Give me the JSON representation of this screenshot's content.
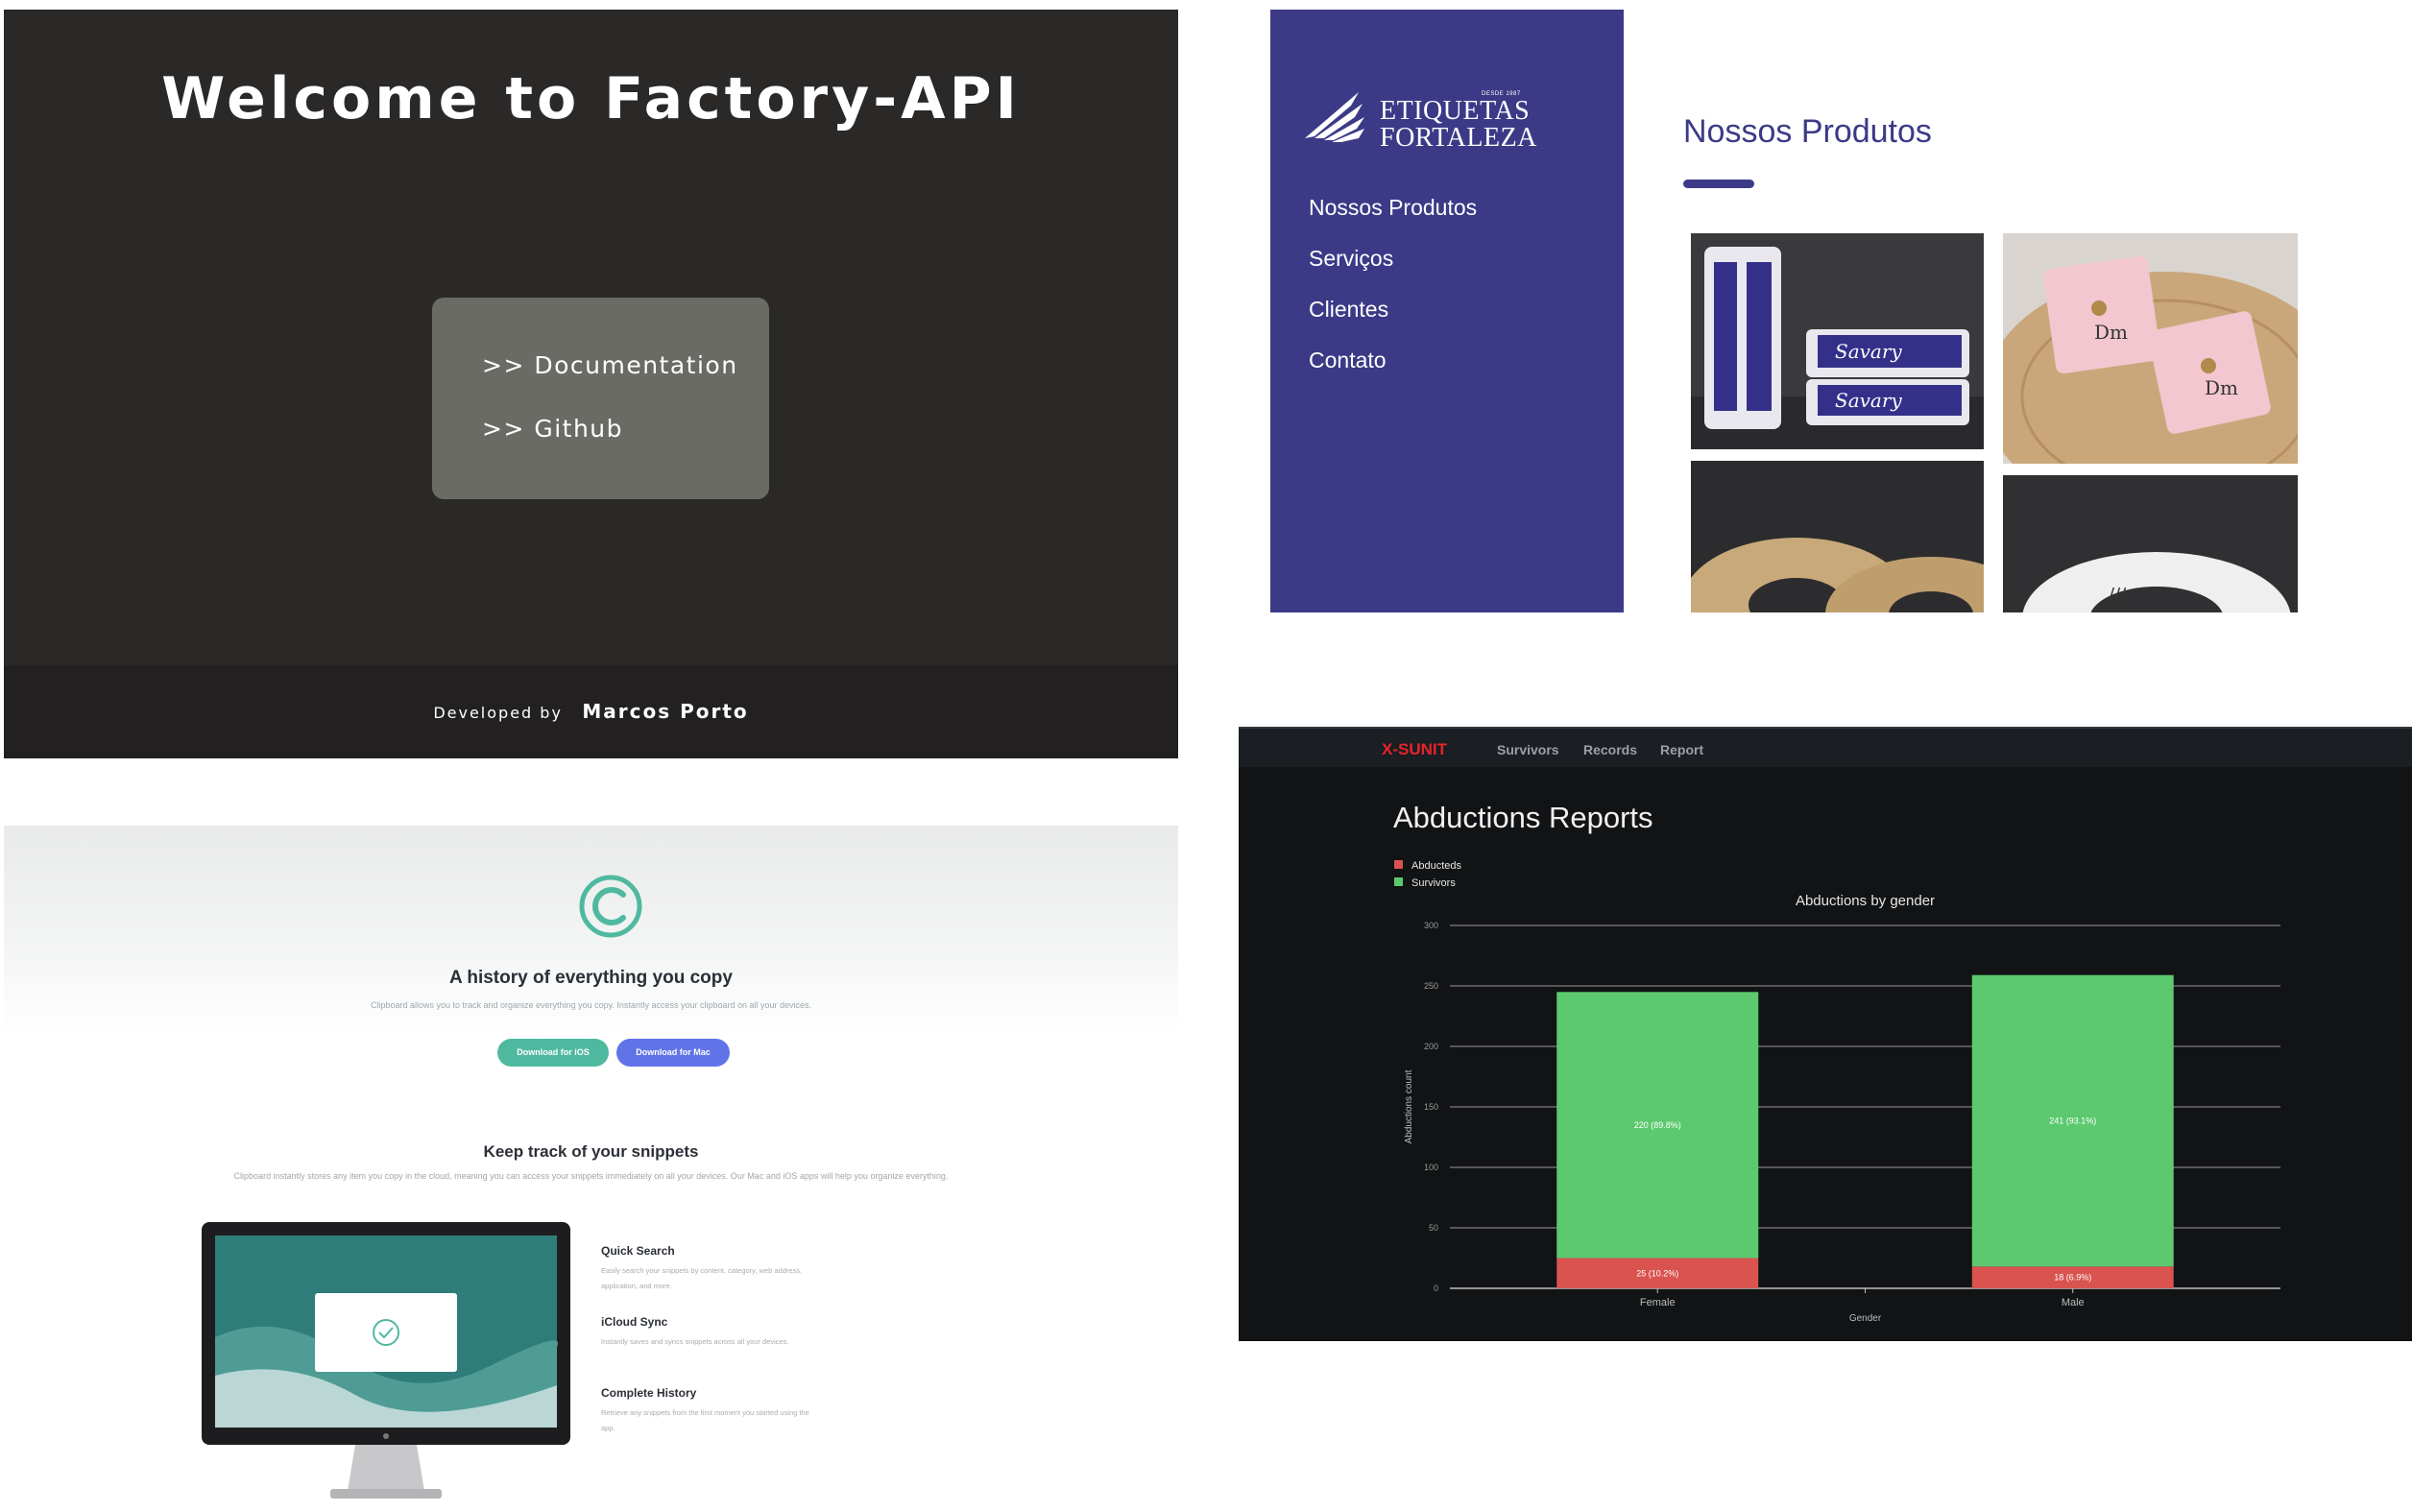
{
  "factory_api": {
    "title": "Welcome to Factory-API",
    "links": [
      ">> Documentation",
      ">> Github"
    ],
    "footer_prefix": "Developed by",
    "footer_author": "Marcos Porto"
  },
  "etiquetas": {
    "logo_since": "DESDE 1987",
    "logo_line1": "ETIQUETAS",
    "logo_line2": "FORTALEZA",
    "nav": [
      "Nossos Produtos",
      "Serviços",
      "Clientes",
      "Contato"
    ],
    "section_title": "Nossos Produtos",
    "accent_color": "#3c3a87"
  },
  "clipboard": {
    "headline": "A history of everything you copy",
    "subline": "Clipboard allows you to track and organize everything you copy. Instantly access your clipboard on all your devices.",
    "btn_ios": "Download for iOS",
    "btn_mac": "Download for Mac",
    "section_title": "Keep track of your snippets",
    "section_sub": "Clipboard instantly stores any item you copy in the cloud, meaning you can access your snippets immediately on all your devices. Our Mac and iOS apps will help you organize everything.",
    "features": [
      {
        "title": "Quick Search",
        "desc": "Easily search your snippets by content, category, web address, application, and more."
      },
      {
        "title": "iCloud Sync",
        "desc": "Instantly saves and syncs snippets across all your devices."
      },
      {
        "title": "Complete History",
        "desc": "Retrieve any snippets from the first moment you started using the app."
      }
    ],
    "colors": {
      "ios": "#4fb9a0",
      "mac": "#6074e8",
      "accent": "#4fb9a0"
    }
  },
  "xsunit": {
    "brand": "X-SUNIT",
    "nav": [
      "Survivors",
      "Records",
      "Report"
    ],
    "page_title": "Abductions Reports",
    "chart_data": {
      "type": "bar",
      "stacked": true,
      "title": "Abductions by gender",
      "xlabel": "Gender",
      "ylabel": "Abductions count",
      "categories": [
        "Female",
        "Male"
      ],
      "ylim": [
        0,
        300
      ],
      "yticks": [
        "0",
        "50",
        "100",
        "150",
        "200",
        "250",
        "300"
      ],
      "series": [
        {
          "name": "Abducteds",
          "color": "#d9534f",
          "values": [
            25,
            18
          ],
          "labels": [
            "25 (10.2%)",
            "18 (6.9%)"
          ]
        },
        {
          "name": "Survivors",
          "color": "#5cc96f",
          "values": [
            220,
            241
          ],
          "labels": [
            "220 (89.8%)",
            "241 (93.1%)"
          ]
        }
      ],
      "legend": "top-left",
      "grid": true
    }
  }
}
